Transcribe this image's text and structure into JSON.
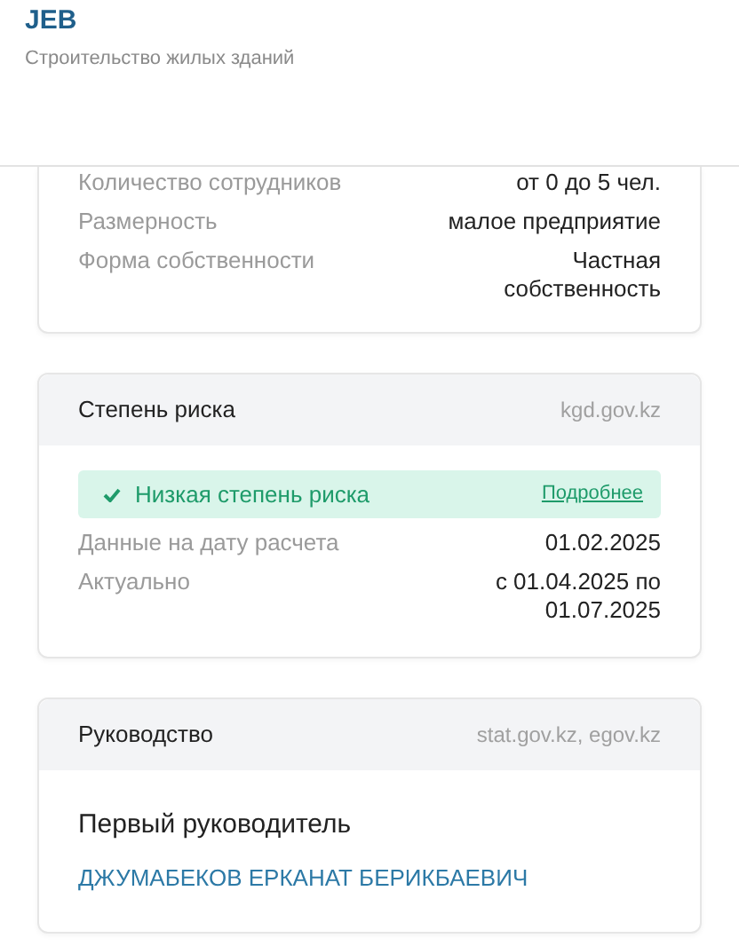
{
  "header": {
    "title": "JEB",
    "subtitle": "Строительство жилых зданий"
  },
  "details": [
    {
      "label": "Количество сотрудников",
      "value": "от 0 до 5 чел."
    },
    {
      "label": "Размерность",
      "value": "малое предприятие"
    },
    {
      "label": "Форма собственности",
      "value": "Частная собственность"
    }
  ],
  "risk": {
    "title": "Степень риска",
    "source": "kgd.gov.kz",
    "status": "Низкая степень риска",
    "link": "Подробнее",
    "rows": [
      {
        "label": "Данные на дату расчета",
        "value": "01.02.2025"
      },
      {
        "label": "Актуально",
        "value": "с 01.04.2025 по 01.07.2025"
      }
    ]
  },
  "management": {
    "title": "Руководство",
    "source": "stat.gov.kz, egov.kz",
    "role": "Первый руководитель",
    "person": "ДЖУМАБЕКОВ ЕРКАНАТ БЕРИКБАЕВИЧ"
  }
}
